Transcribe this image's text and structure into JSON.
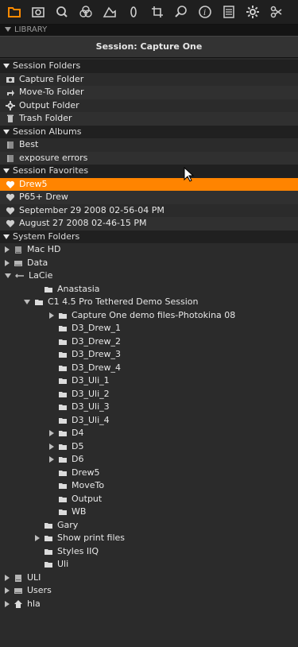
{
  "toolbar": {
    "accent_color": "#ff8a00",
    "icons": [
      "folder-icon",
      "camera-icon",
      "search-icon",
      "color-balance-icon",
      "exposure-icon",
      "lens-icon",
      "crop-icon",
      "loupe-icon",
      "info-icon",
      "metadata-icon",
      "gear-icon",
      "output-icon"
    ]
  },
  "library": {
    "header": "LIBRARY",
    "session_title": "Session: Capture One"
  },
  "colors": {
    "selected_row": "#ff8400"
  },
  "session_folders": {
    "title": "Session Folders",
    "items": [
      {
        "label": "Capture Folder"
      },
      {
        "label": "Move-To Folder"
      },
      {
        "label": "Output Folder"
      },
      {
        "label": "Trash Folder"
      }
    ]
  },
  "session_albums": {
    "title": "Session Albums",
    "items": [
      {
        "label": "Best"
      },
      {
        "label": "exposure errors"
      }
    ]
  },
  "session_favorites": {
    "title": "Session Favorites",
    "items": [
      {
        "label": "Drew5"
      },
      {
        "label": "P65+ Drew"
      },
      {
        "label": "September 29 2008 02-56-04 PM"
      },
      {
        "label": "August 27 2008 02-46-15 PM"
      }
    ]
  },
  "system_folders": {
    "title": "System Folders",
    "items": [
      {
        "label": "Mac HD"
      },
      {
        "label": "Data"
      },
      {
        "label": "LaCie"
      },
      {
        "label": "Anastasia"
      },
      {
        "label": "C1 4.5 Pro Tethered Demo Session"
      },
      {
        "label": "Capture One demo files-Photokina 08"
      },
      {
        "label": "D3_Drew_1"
      },
      {
        "label": "D3_Drew_2"
      },
      {
        "label": "D3_Drew_3"
      },
      {
        "label": "D3_Drew_4"
      },
      {
        "label": "D3_Uli_1"
      },
      {
        "label": "D3_Uli_2"
      },
      {
        "label": "D3_Uli_3"
      },
      {
        "label": "D3_Uli_4"
      },
      {
        "label": "D4"
      },
      {
        "label": "D5"
      },
      {
        "label": "D6"
      },
      {
        "label": "Drew5"
      },
      {
        "label": "MoveTo"
      },
      {
        "label": "Output"
      },
      {
        "label": "WB"
      },
      {
        "label": "Gary"
      },
      {
        "label": "Show print files"
      },
      {
        "label": "Styles IIQ"
      },
      {
        "label": "Uli"
      },
      {
        "label": "ULI"
      },
      {
        "label": "Users"
      },
      {
        "label": "hla"
      }
    ]
  }
}
